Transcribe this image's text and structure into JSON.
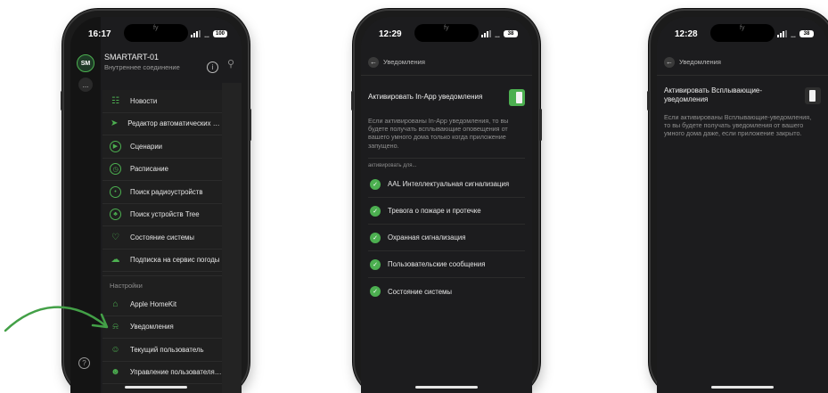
{
  "phone1": {
    "time": "16:17",
    "battery": "100",
    "avatar": "SM",
    "dots": "...",
    "connection_name": "SMARTART-01",
    "connection_type": "Внутреннее соединение",
    "menu": [
      {
        "label": "Новости",
        "icon": "news-icon"
      },
      {
        "label": "Редактор автоматических сценариев",
        "icon": "send-icon"
      },
      {
        "label": "Сценарии",
        "icon": "play-icon"
      },
      {
        "label": "Расписание",
        "icon": "clock-icon"
      },
      {
        "label": "Поиск радиоустройств",
        "icon": "radio-icon"
      },
      {
        "label": "Поиск устройств Tree",
        "icon": "tree-icon"
      },
      {
        "label": "Состояние системы",
        "icon": "heart-icon"
      },
      {
        "label": "Подписка на сервис погоды",
        "icon": "weather-icon"
      }
    ],
    "settings_header": "Настройки",
    "settings": [
      {
        "label": "Apple HomeKit",
        "icon": "home-icon"
      },
      {
        "label": "Уведомления",
        "icon": "bell-icon"
      },
      {
        "label": "Текущий пользователь",
        "icon": "user-icon"
      },
      {
        "label": "Управление пользователями",
        "icon": "users-icon"
      }
    ]
  },
  "phone2": {
    "time": "12:29",
    "battery": "38",
    "header_title": "Уведомления",
    "toggle_label": "Активировать In-App уведомления",
    "toggle_on": true,
    "description": "Если активированы In-App уведомления, то вы будете получать всплывающие оповещения от вашего умного дома только когда приложение запущено.",
    "activate_for": "активировать для...",
    "items": [
      "AAL Интеллектуальная сигнализация",
      "Тревога о пожаре и протечке",
      "Охранная сигнализация",
      "Пользовательские сообщения",
      "Состояние системы"
    ]
  },
  "phone3": {
    "time": "12:28",
    "battery": "38",
    "header_title": "Уведомления",
    "toggle_label": "Активировать Всплывающие-уведомления",
    "toggle_on": false,
    "description": "Если активированы Всплывающие-уведомления, то вы будете получать уведомления от вашего умного дома даже, если приложение закрыто."
  },
  "colors": {
    "accent": "#4caf50",
    "screen_bg": "#1c1c1e",
    "page_bg": "#ffffff"
  }
}
